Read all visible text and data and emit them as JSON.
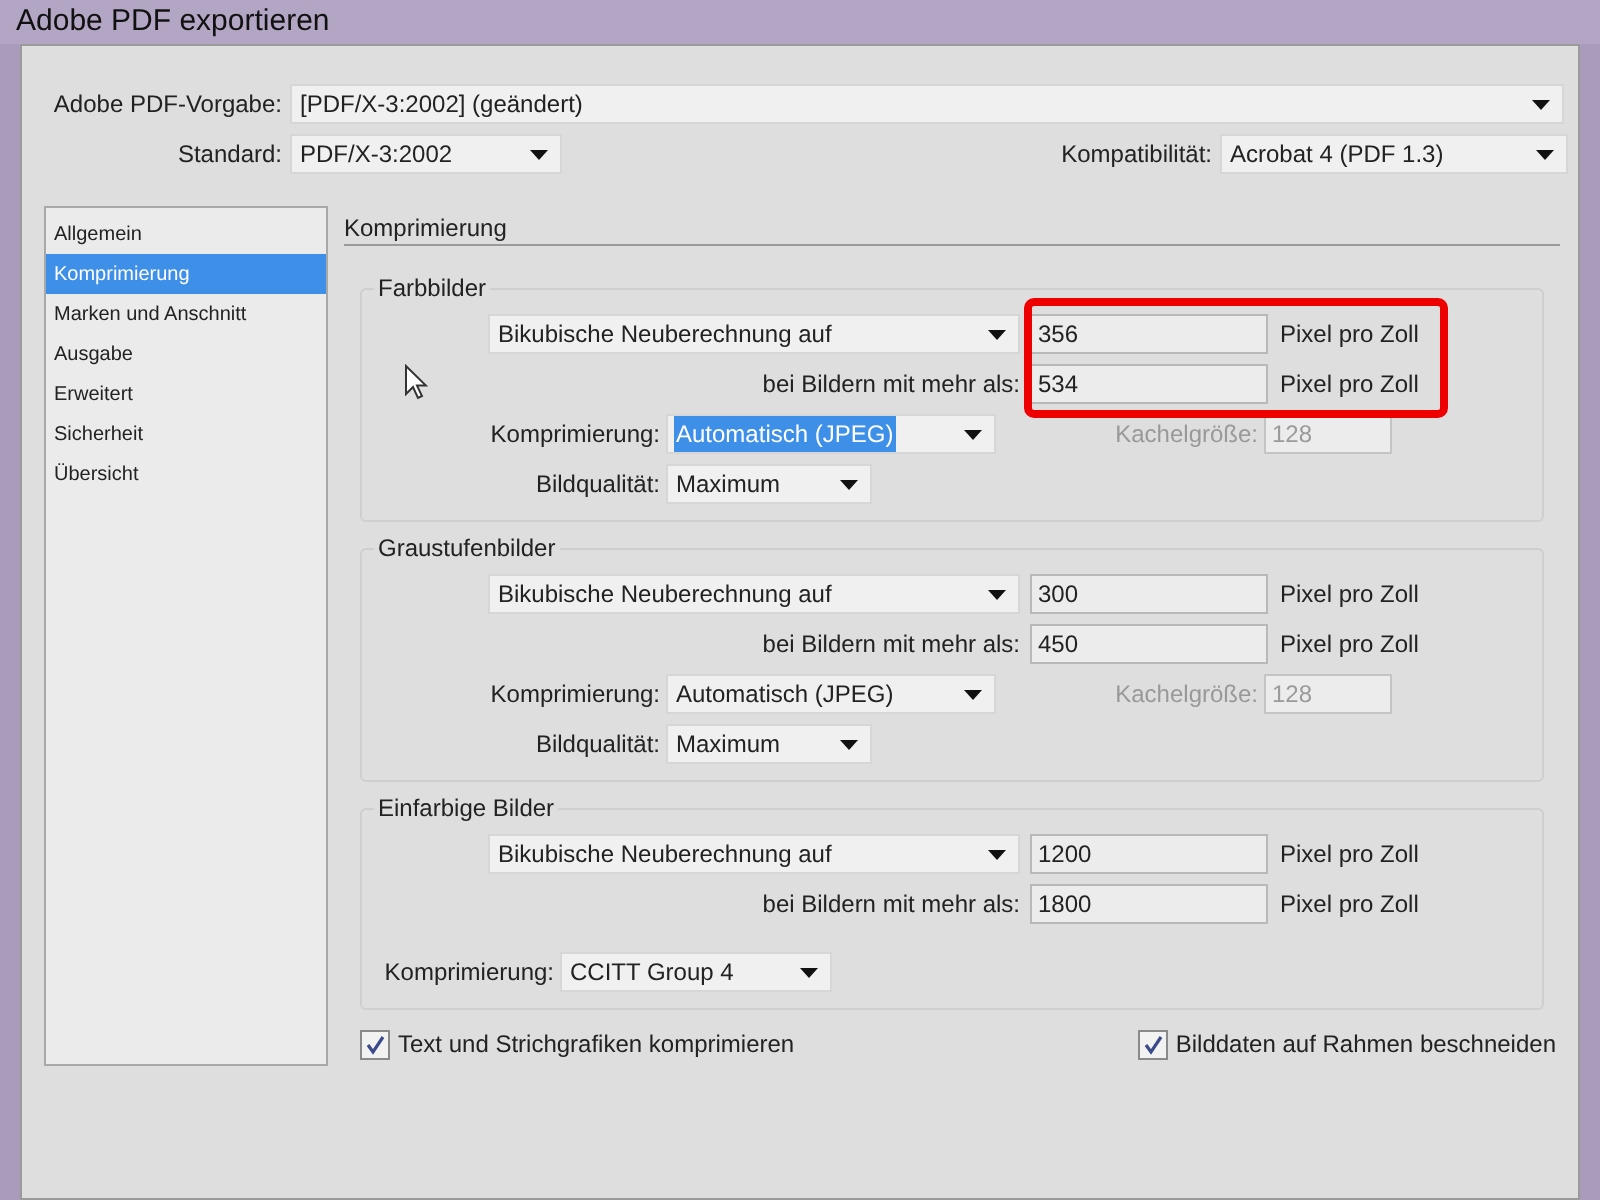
{
  "window": {
    "title": "Adobe PDF exportieren"
  },
  "preset": {
    "label": "Adobe PDF-Vorgabe:",
    "value": "[PDF/X-3:2002] (geändert)"
  },
  "standard": {
    "label": "Standard:",
    "value": "PDF/X-3:2002"
  },
  "compatibility": {
    "label": "Kompatibilität:",
    "value": "Acrobat 4 (PDF 1.3)"
  },
  "sidebar": {
    "items": [
      {
        "label": "Allgemein",
        "selected": false
      },
      {
        "label": "Komprimierung",
        "selected": true
      },
      {
        "label": "Marken und Anschnitt",
        "selected": false
      },
      {
        "label": "Ausgabe",
        "selected": false
      },
      {
        "label": "Erweitert",
        "selected": false
      },
      {
        "label": "Sicherheit",
        "selected": false
      },
      {
        "label": "Übersicht",
        "selected": false
      }
    ]
  },
  "panel": {
    "title": "Komprimierung"
  },
  "groups": [
    {
      "title": "Farbbilder",
      "highlighted": true,
      "resample": "Bikubische Neuberechnung auf",
      "resolution": "356",
      "resolution_unit": "Pixel pro Zoll",
      "threshold_label": "bei Bildern mit mehr als:",
      "threshold": "534",
      "threshold_unit": "Pixel pro Zoll",
      "compression_label": "Komprimierung:",
      "compression": "Automatisch (JPEG)",
      "compression_focused": true,
      "tile_label": "Kachelgröße:",
      "tile": "128",
      "quality_label": "Bildqualität:",
      "quality": "Maximum"
    },
    {
      "title": "Graustufenbilder",
      "highlighted": false,
      "resample": "Bikubische Neuberechnung auf",
      "resolution": "300",
      "resolution_unit": "Pixel pro Zoll",
      "threshold_label": "bei Bildern mit mehr als:",
      "threshold": "450",
      "threshold_unit": "Pixel pro Zoll",
      "compression_label": "Komprimierung:",
      "compression": "Automatisch (JPEG)",
      "compression_focused": false,
      "tile_label": "Kachelgröße:",
      "tile": "128",
      "quality_label": "Bildqualität:",
      "quality": "Maximum"
    },
    {
      "title": "Einfarbige Bilder",
      "highlighted": false,
      "resample": "Bikubische Neuberechnung auf",
      "resolution": "1200",
      "resolution_unit": "Pixel pro Zoll",
      "threshold_label": "bei Bildern mit mehr als:",
      "threshold": "1800",
      "threshold_unit": "Pixel pro Zoll",
      "compression_label": "Komprimierung:",
      "compression": "CCITT Group 4",
      "compression_focused": false
    }
  ],
  "options": [
    {
      "label": "Text und Strichgrafiken komprimieren",
      "checked": true
    },
    {
      "label": "Bilddaten auf Rahmen beschneiden",
      "checked": true
    }
  ]
}
